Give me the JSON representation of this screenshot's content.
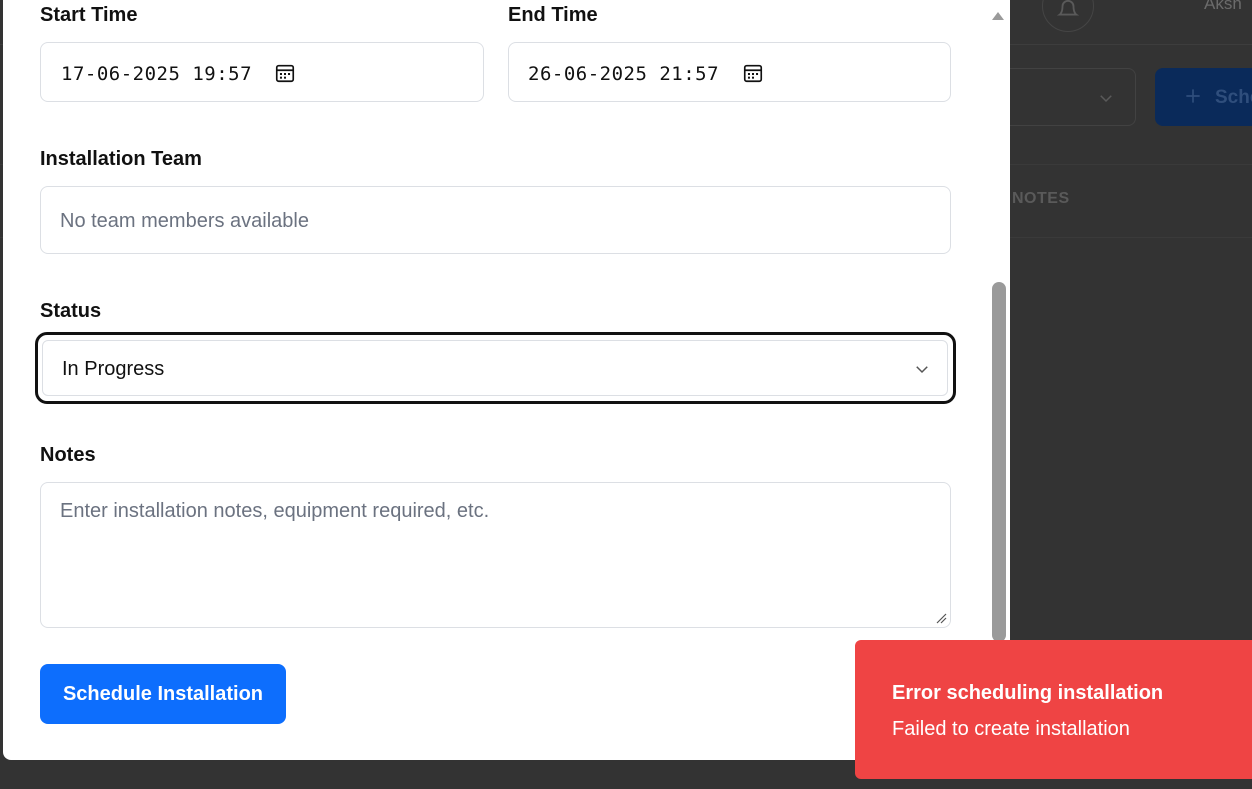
{
  "background": {
    "user_name": "Aksh",
    "schedule_button_label": "Sche",
    "notes_column_header": "NOTES"
  },
  "form": {
    "start_time": {
      "label": "Start Time",
      "value": "17-06-2025  19:57"
    },
    "end_time": {
      "label": "End Time",
      "value": "26-06-2025  21:57"
    },
    "installation_team": {
      "label": "Installation Team",
      "placeholder": "No team members available"
    },
    "status": {
      "label": "Status",
      "value": "In Progress"
    },
    "notes": {
      "label": "Notes",
      "placeholder": "Enter installation notes, equipment required, etc.",
      "value": ""
    },
    "submit_label": "Schedule Installation"
  },
  "toast": {
    "title": "Error scheduling installation",
    "description": "Failed to create installation"
  },
  "colors": {
    "primary": "#0d6efd",
    "error": "#ef4444",
    "overlay": "#333333"
  },
  "icons": [
    "calendar-icon",
    "chevron-down-icon",
    "bell-icon",
    "plus-icon",
    "scroll-up-arrow-icon",
    "resize-handle-icon"
  ]
}
